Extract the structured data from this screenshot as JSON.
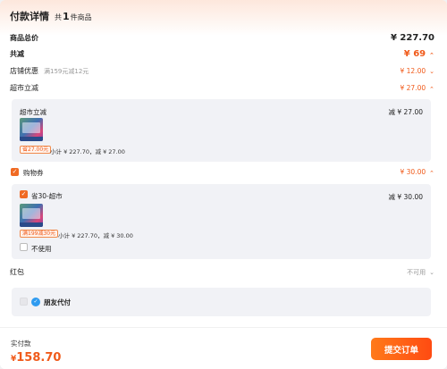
{
  "header": {
    "title": "付款详情",
    "count_prefix": "共",
    "count": "1",
    "count_suffix": "件商品"
  },
  "summary": {
    "total_label": "商品总价",
    "total_value": "¥ 227.70",
    "discount_label": "共减",
    "discount_value": "¥ 69",
    "shop_label": "店铺优惠",
    "shop_note": "满159元减12元",
    "shop_value": "¥ 12.00",
    "market_label": "超市立减",
    "market_value": "¥ 27.00"
  },
  "market_box": {
    "title": "超市立减",
    "value": "减 ¥ 27.00",
    "tag": "省27.00元",
    "subtotal": "小计 ¥ 227.70，减 ¥ 27.00"
  },
  "coupon": {
    "label": "购物券",
    "value": "¥ 30.00",
    "check": "✓",
    "option_label": "省30-超市",
    "option_value": "减 ¥ 30.00",
    "tag": "满199减30元",
    "subtotal": "小计 ¥ 227.70，减 ¥ 30.00",
    "not_use_label": "不使用"
  },
  "red_packet": {
    "label": "红包",
    "value": "不可用"
  },
  "friend_pay": {
    "label": "朋友代付",
    "icon": "friend-pay-icon"
  },
  "footer": {
    "pay_label": "实付款",
    "currency": "¥",
    "amount": "158.70",
    "submit_label": "提交订单"
  },
  "colors": {
    "accent": "#f05a1a",
    "button": "#ff5a14",
    "box_bg": "#f1f2f6"
  }
}
